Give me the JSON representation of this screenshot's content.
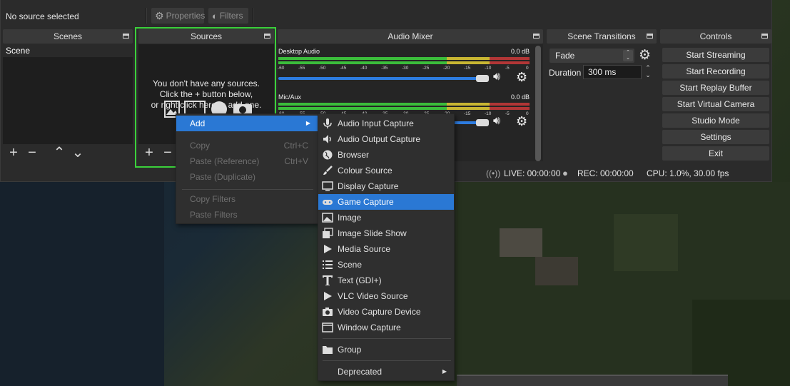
{
  "topbar": {
    "status_text": "No source selected",
    "properties_label": "Properties",
    "filters_label": "Filters"
  },
  "docks": {
    "scenes": {
      "title": "Scenes",
      "items": [
        "Scene"
      ]
    },
    "sources": {
      "title": "Sources",
      "empty_line1": "You don't have any sources.",
      "empty_line2": "Click the + button below,",
      "empty_line3": "or right click here to add one."
    },
    "mixer": {
      "title": "Audio Mixer",
      "channels": [
        {
          "name": "Desktop Audio",
          "level": "0.0 dB"
        },
        {
          "name": "Mic/Aux",
          "level": "0.0 dB"
        }
      ],
      "ticks": [
        "-60",
        "-55",
        "-50",
        "-45",
        "-40",
        "-35",
        "-30",
        "-25",
        "-20",
        "-15",
        "-10",
        "-5",
        "0"
      ]
    },
    "transitions": {
      "title": "Scene Transitions",
      "transition": "Fade",
      "duration_label": "Duration",
      "duration_value": "300 ms"
    },
    "controls": {
      "title": "Controls",
      "buttons": [
        "Start Streaming",
        "Start Recording",
        "Start Replay Buffer",
        "Start Virtual Camera",
        "Studio Mode",
        "Settings",
        "Exit"
      ]
    }
  },
  "statusbar": {
    "live": "LIVE: 00:00:00",
    "rec": "REC: 00:00:00",
    "cpu": "CPU: 1.0%, 30.00 fps"
  },
  "context_menu": {
    "items": [
      {
        "label": "Add",
        "highlighted": true,
        "submenu": true
      },
      {
        "label": "Copy",
        "shortcut": "Ctrl+C",
        "disabled": true
      },
      {
        "label": "Paste (Reference)",
        "shortcut": "Ctrl+V",
        "disabled": true
      },
      {
        "label": "Paste (Duplicate)",
        "disabled": true
      },
      {
        "label": "Copy Filters",
        "disabled": true
      },
      {
        "label": "Paste Filters",
        "disabled": true
      }
    ]
  },
  "add_menu": {
    "items": [
      {
        "label": "Audio Input Capture",
        "icon": "microphone-icon"
      },
      {
        "label": "Audio Output Capture",
        "icon": "speaker-icon"
      },
      {
        "label": "Browser",
        "icon": "globe-icon"
      },
      {
        "label": "Colour Source",
        "icon": "brush-icon"
      },
      {
        "label": "Display Capture",
        "icon": "monitor-icon"
      },
      {
        "label": "Game Capture",
        "icon": "gamepad-icon",
        "highlighted": true
      },
      {
        "label": "Image",
        "icon": "image-icon"
      },
      {
        "label": "Image Slide Show",
        "icon": "slideshow-icon"
      },
      {
        "label": "Media Source",
        "icon": "play-icon"
      },
      {
        "label": "Scene",
        "icon": "list-icon"
      },
      {
        "label": "Text (GDI+)",
        "icon": "text-icon"
      },
      {
        "label": "VLC Video Source",
        "icon": "play-icon"
      },
      {
        "label": "Video Capture Device",
        "icon": "camera-icon"
      },
      {
        "label": "Window Capture",
        "icon": "window-icon"
      },
      {
        "label": "Group",
        "icon": "folder-icon"
      },
      {
        "label": "Deprecated",
        "submenu": true
      }
    ]
  },
  "colors": {
    "accent": "#2a78d4",
    "highlight_border": "#3bd13b",
    "panel_bg": "#1e1e1e",
    "window_bg": "#2b2b2b"
  }
}
